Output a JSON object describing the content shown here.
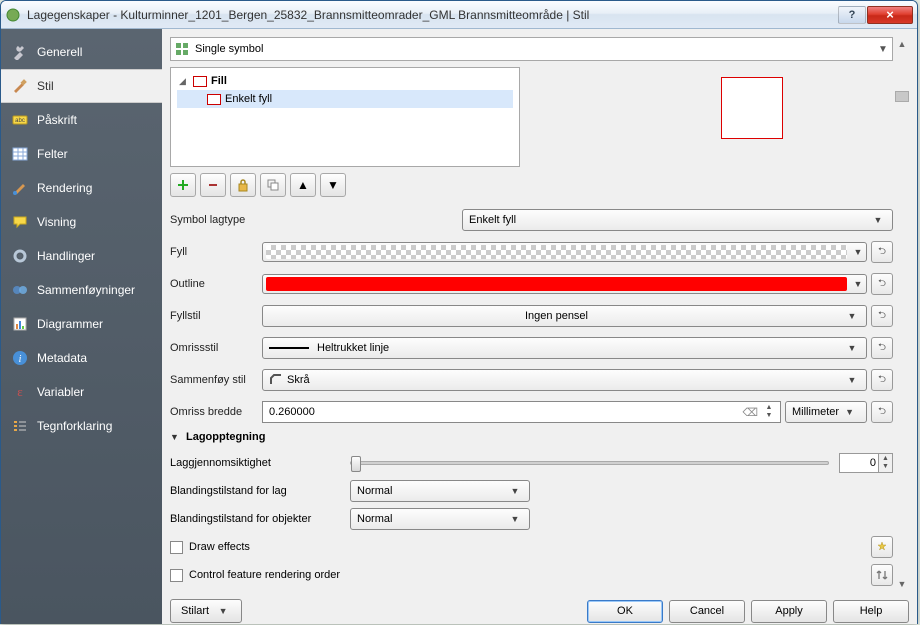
{
  "window": {
    "title": "Lagegenskaper - Kulturminner_1201_Bergen_25832_Brannsmitteomrader_GML Brannsmitteområde | Stil"
  },
  "sidebar": {
    "items": [
      {
        "label": "Generell"
      },
      {
        "label": "Stil"
      },
      {
        "label": "Påskrift"
      },
      {
        "label": "Felter"
      },
      {
        "label": "Rendering"
      },
      {
        "label": "Visning"
      },
      {
        "label": "Handlinger"
      },
      {
        "label": "Sammenføyninger"
      },
      {
        "label": "Diagrammer"
      },
      {
        "label": "Metadata"
      },
      {
        "label": "Variabler"
      },
      {
        "label": "Tegnforklaring"
      }
    ],
    "active_index": 1
  },
  "symbol": {
    "renderer_type": "Single symbol",
    "tree": {
      "root": "Fill",
      "child": "Enkelt fyll"
    },
    "layer_type_label": "Symbol lagtype",
    "layer_type_value": "Enkelt fyll",
    "props": {
      "fill_label": "Fyll",
      "outline_label": "Outline",
      "outline_color": "#ff0000",
      "fillstyle_label": "Fyllstil",
      "fillstyle_value": "Ingen pensel",
      "outlinestyle_label": "Omrissstil",
      "outlinestyle_value": "Heltrukket linje",
      "joinstyle_label": "Sammenføy stil",
      "joinstyle_value": "Skrå",
      "outlinewidth_label": "Omriss bredde",
      "outlinewidth_value": "0.260000",
      "unit": "Millimeter"
    }
  },
  "rendering": {
    "section_title": "Lagopptegning",
    "opacity_label": "Laggjennomsiktighet",
    "opacity_value": "0",
    "blend_layer_label": "Blandingstilstand for lag",
    "blend_layer_value": "Normal",
    "blend_feature_label": "Blandingstilstand for objekter",
    "blend_feature_value": "Normal",
    "draw_effects_label": "Draw effects",
    "control_order_label": "Control feature rendering order"
  },
  "footer": {
    "style": "Stilart",
    "ok": "OK",
    "cancel": "Cancel",
    "apply": "Apply",
    "help": "Help"
  }
}
